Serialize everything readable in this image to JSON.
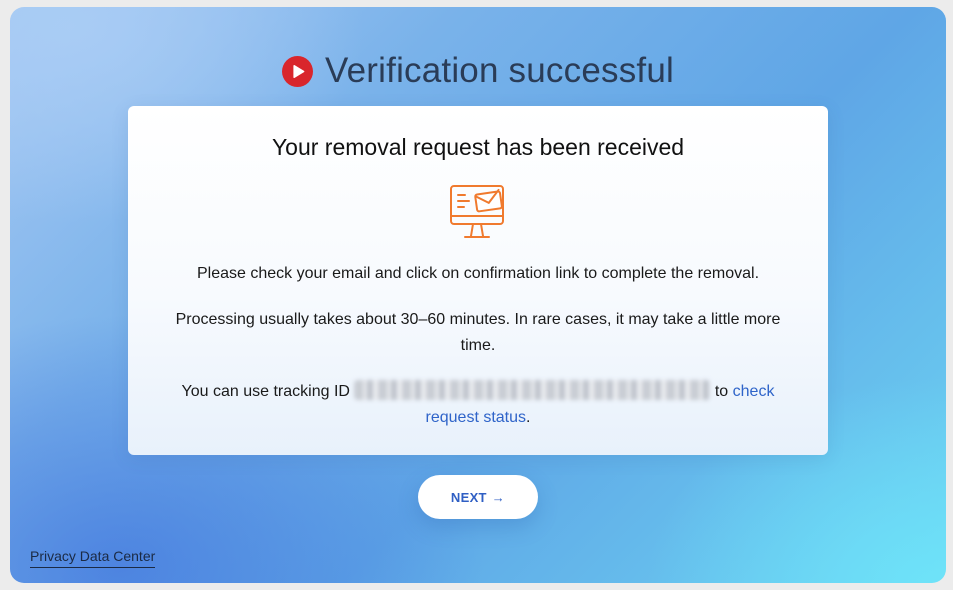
{
  "header": {
    "icon": "play-circle-icon",
    "brand_color": "#d9262c",
    "title": "Verification successful"
  },
  "card": {
    "heading": "Your removal request has been received",
    "illustration_icon": "monitor-mail-icon",
    "illustration_color": "#f07a2e",
    "paragraph_1": "Please check your email and click on confirmation link to complete the removal.",
    "paragraph_2": "Processing usually takes about 30–60 minutes. In rare cases, it may take a little more time.",
    "tracking_prefix": "You can use tracking ID",
    "tracking_id_redacted": "xxxxxxxx-xxxx-xxxx-xxxx-xxxxxxxxxxxx",
    "tracking_mid": "to",
    "status_link": "check request status",
    "tracking_suffix": ".",
    "link_color": "#2f64c9"
  },
  "actions": {
    "next_label": "NEXT",
    "next_icon": "arrow-right-icon"
  },
  "footer": {
    "privacy_link": "Privacy Data Center"
  }
}
